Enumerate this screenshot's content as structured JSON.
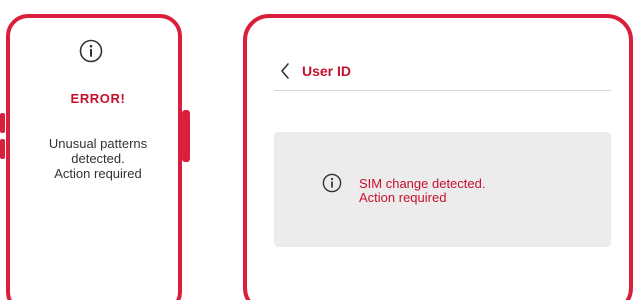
{
  "left_phone": {
    "icon": "info-icon",
    "error_title": "ERROR!",
    "error_message": "Unusual patterns\ndetected.\nAction required"
  },
  "right_phone": {
    "back_icon": "chevron-left-icon",
    "title": "User ID",
    "alert": {
      "icon": "info-icon",
      "message": "SIM change detected.\nAction required"
    }
  },
  "colors": {
    "accent": "#d81f3c",
    "text_accent": "#c8102e",
    "alert_bg": "#ececec",
    "body_text": "#333333"
  }
}
